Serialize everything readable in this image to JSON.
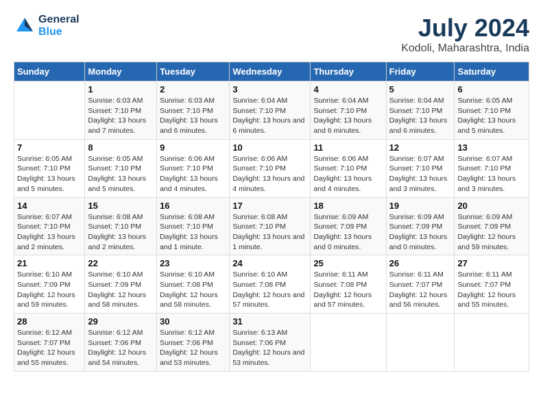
{
  "app": {
    "name": "GeneralBlue",
    "logo_line1": "General",
    "logo_line2": "Blue"
  },
  "calendar": {
    "title": "July 2024",
    "subtitle": "Kodoli, Maharashtra, India",
    "headers": [
      "Sunday",
      "Monday",
      "Tuesday",
      "Wednesday",
      "Thursday",
      "Friday",
      "Saturday"
    ],
    "weeks": [
      [
        {
          "day": "",
          "sunrise": "",
          "sunset": "",
          "daylight": ""
        },
        {
          "day": "1",
          "sunrise": "Sunrise: 6:03 AM",
          "sunset": "Sunset: 7:10 PM",
          "daylight": "Daylight: 13 hours and 7 minutes."
        },
        {
          "day": "2",
          "sunrise": "Sunrise: 6:03 AM",
          "sunset": "Sunset: 7:10 PM",
          "daylight": "Daylight: 13 hours and 6 minutes."
        },
        {
          "day": "3",
          "sunrise": "Sunrise: 6:04 AM",
          "sunset": "Sunset: 7:10 PM",
          "daylight": "Daylight: 13 hours and 6 minutes."
        },
        {
          "day": "4",
          "sunrise": "Sunrise: 6:04 AM",
          "sunset": "Sunset: 7:10 PM",
          "daylight": "Daylight: 13 hours and 6 minutes."
        },
        {
          "day": "5",
          "sunrise": "Sunrise: 6:04 AM",
          "sunset": "Sunset: 7:10 PM",
          "daylight": "Daylight: 13 hours and 6 minutes."
        },
        {
          "day": "6",
          "sunrise": "Sunrise: 6:05 AM",
          "sunset": "Sunset: 7:10 PM",
          "daylight": "Daylight: 13 hours and 5 minutes."
        }
      ],
      [
        {
          "day": "7",
          "sunrise": "Sunrise: 6:05 AM",
          "sunset": "Sunset: 7:10 PM",
          "daylight": "Daylight: 13 hours and 5 minutes."
        },
        {
          "day": "8",
          "sunrise": "Sunrise: 6:05 AM",
          "sunset": "Sunset: 7:10 PM",
          "daylight": "Daylight: 13 hours and 5 minutes."
        },
        {
          "day": "9",
          "sunrise": "Sunrise: 6:06 AM",
          "sunset": "Sunset: 7:10 PM",
          "daylight": "Daylight: 13 hours and 4 minutes."
        },
        {
          "day": "10",
          "sunrise": "Sunrise: 6:06 AM",
          "sunset": "Sunset: 7:10 PM",
          "daylight": "Daylight: 13 hours and 4 minutes."
        },
        {
          "day": "11",
          "sunrise": "Sunrise: 6:06 AM",
          "sunset": "Sunset: 7:10 PM",
          "daylight": "Daylight: 13 hours and 4 minutes."
        },
        {
          "day": "12",
          "sunrise": "Sunrise: 6:07 AM",
          "sunset": "Sunset: 7:10 PM",
          "daylight": "Daylight: 13 hours and 3 minutes."
        },
        {
          "day": "13",
          "sunrise": "Sunrise: 6:07 AM",
          "sunset": "Sunset: 7:10 PM",
          "daylight": "Daylight: 13 hours and 3 minutes."
        }
      ],
      [
        {
          "day": "14",
          "sunrise": "Sunrise: 6:07 AM",
          "sunset": "Sunset: 7:10 PM",
          "daylight": "Daylight: 13 hours and 2 minutes."
        },
        {
          "day": "15",
          "sunrise": "Sunrise: 6:08 AM",
          "sunset": "Sunset: 7:10 PM",
          "daylight": "Daylight: 13 hours and 2 minutes."
        },
        {
          "day": "16",
          "sunrise": "Sunrise: 6:08 AM",
          "sunset": "Sunset: 7:10 PM",
          "daylight": "Daylight: 13 hours and 1 minute."
        },
        {
          "day": "17",
          "sunrise": "Sunrise: 6:08 AM",
          "sunset": "Sunset: 7:10 PM",
          "daylight": "Daylight: 13 hours and 1 minute."
        },
        {
          "day": "18",
          "sunrise": "Sunrise: 6:09 AM",
          "sunset": "Sunset: 7:09 PM",
          "daylight": "Daylight: 13 hours and 0 minutes."
        },
        {
          "day": "19",
          "sunrise": "Sunrise: 6:09 AM",
          "sunset": "Sunset: 7:09 PM",
          "daylight": "Daylight: 13 hours and 0 minutes."
        },
        {
          "day": "20",
          "sunrise": "Sunrise: 6:09 AM",
          "sunset": "Sunset: 7:09 PM",
          "daylight": "Daylight: 12 hours and 59 minutes."
        }
      ],
      [
        {
          "day": "21",
          "sunrise": "Sunrise: 6:10 AM",
          "sunset": "Sunset: 7:09 PM",
          "daylight": "Daylight: 12 hours and 59 minutes."
        },
        {
          "day": "22",
          "sunrise": "Sunrise: 6:10 AM",
          "sunset": "Sunset: 7:09 PM",
          "daylight": "Daylight: 12 hours and 58 minutes."
        },
        {
          "day": "23",
          "sunrise": "Sunrise: 6:10 AM",
          "sunset": "Sunset: 7:08 PM",
          "daylight": "Daylight: 12 hours and 58 minutes."
        },
        {
          "day": "24",
          "sunrise": "Sunrise: 6:10 AM",
          "sunset": "Sunset: 7:08 PM",
          "daylight": "Daylight: 12 hours and 57 minutes."
        },
        {
          "day": "25",
          "sunrise": "Sunrise: 6:11 AM",
          "sunset": "Sunset: 7:08 PM",
          "daylight": "Daylight: 12 hours and 57 minutes."
        },
        {
          "day": "26",
          "sunrise": "Sunrise: 6:11 AM",
          "sunset": "Sunset: 7:07 PM",
          "daylight": "Daylight: 12 hours and 56 minutes."
        },
        {
          "day": "27",
          "sunrise": "Sunrise: 6:11 AM",
          "sunset": "Sunset: 7:07 PM",
          "daylight": "Daylight: 12 hours and 55 minutes."
        }
      ],
      [
        {
          "day": "28",
          "sunrise": "Sunrise: 6:12 AM",
          "sunset": "Sunset: 7:07 PM",
          "daylight": "Daylight: 12 hours and 55 minutes."
        },
        {
          "day": "29",
          "sunrise": "Sunrise: 6:12 AM",
          "sunset": "Sunset: 7:06 PM",
          "daylight": "Daylight: 12 hours and 54 minutes."
        },
        {
          "day": "30",
          "sunrise": "Sunrise: 6:12 AM",
          "sunset": "Sunset: 7:06 PM",
          "daylight": "Daylight: 12 hours and 53 minutes."
        },
        {
          "day": "31",
          "sunrise": "Sunrise: 6:13 AM",
          "sunset": "Sunset: 7:06 PM",
          "daylight": "Daylight: 12 hours and 53 minutes."
        },
        {
          "day": "",
          "sunrise": "",
          "sunset": "",
          "daylight": ""
        },
        {
          "day": "",
          "sunrise": "",
          "sunset": "",
          "daylight": ""
        },
        {
          "day": "",
          "sunrise": "",
          "sunset": "",
          "daylight": ""
        }
      ]
    ]
  }
}
